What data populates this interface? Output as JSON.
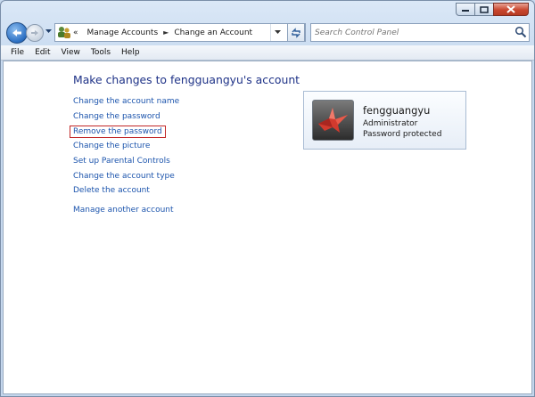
{
  "window": {
    "caption_buttons": [
      "minimize",
      "maximize",
      "close"
    ]
  },
  "navigation": {
    "breadcrumb": {
      "overflow": "«",
      "items": [
        "Manage Accounts",
        "Change an Account"
      ],
      "separator": "►"
    },
    "search_placeholder": "Search Control Panel"
  },
  "menu": {
    "items": [
      "File",
      "Edit",
      "View",
      "Tools",
      "Help"
    ]
  },
  "main": {
    "heading": "Make changes to fengguangyu's account",
    "tasks": [
      {
        "label": "Change the account name",
        "highlighted": false
      },
      {
        "label": "Change the password",
        "highlighted": false
      },
      {
        "label": "Remove the password",
        "highlighted": true
      },
      {
        "label": "Change the picture",
        "highlighted": false
      },
      {
        "label": "Set up Parental Controls",
        "highlighted": false
      },
      {
        "label": "Change the account type",
        "highlighted": false
      },
      {
        "label": "Delete the account",
        "highlighted": false
      },
      {
        "label": "Manage another account",
        "highlighted": false
      }
    ]
  },
  "account": {
    "name": "fengguangyu",
    "type": "Administrator",
    "status": "Password protected"
  },
  "colors": {
    "link": "#1d55ad",
    "heading": "#1e3287",
    "highlight_box": "#c12626"
  }
}
